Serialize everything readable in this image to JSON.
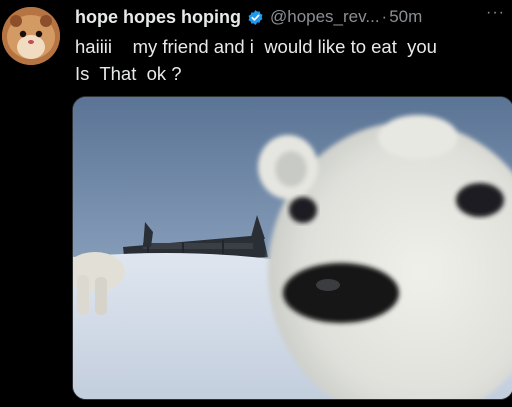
{
  "tweet": {
    "display_name": "hope hopes hoping",
    "handle": "@hopes_rev...",
    "separator": "·",
    "time": "50m",
    "more_icon": "···",
    "text_line1": "haiiii    my friend and i  would like to eat  you",
    "text_line2": "Is  That  ok ?"
  },
  "icons": {
    "verified": "verified-badge-icon",
    "more": "more-options-icon"
  },
  "colors": {
    "background": "#000000",
    "text": "#e7e9ea",
    "muted": "#8b8f93",
    "verified": "#1d9bf0"
  }
}
